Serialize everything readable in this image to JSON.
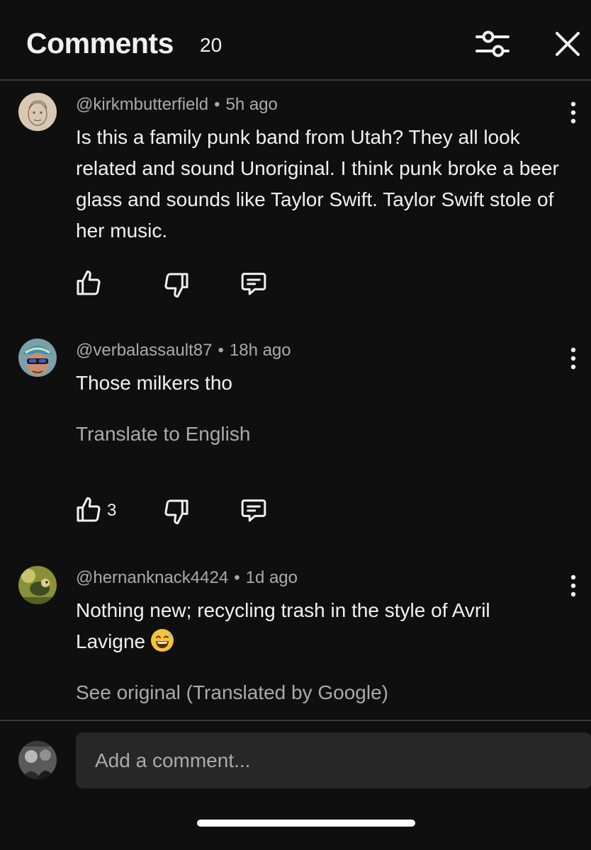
{
  "header": {
    "title": "Comments",
    "count": "20",
    "filter_icon": "filter-sliders-icon",
    "close_icon": "close-icon"
  },
  "comments": [
    {
      "author": "@kirkmbutterfield",
      "time": "5h ago",
      "text": "Is this a family punk band from Utah? They all look related and sound Unoriginal. I think punk broke a beer glass and sounds like Taylor Swift. Taylor Swift stole of her music.",
      "likes": "",
      "avatar_icon": "sketch-portrait-avatar"
    },
    {
      "author": "@verbalassault87",
      "time": "18h ago",
      "text": "Those milkers tho",
      "translate": "Translate to English",
      "likes": "3",
      "avatar_icon": "sunglasses-hat-avatar"
    },
    {
      "author": "@hernanknack4424",
      "time": "1d ago",
      "text": "Nothing new; recycling trash in the style of Avril Lavigne",
      "emoji": "grinning-sweat-emoji",
      "translate": "See original (Translated by Google)",
      "avatar_icon": "bird-photo-avatar"
    }
  ],
  "composer": {
    "placeholder": "Add a comment...",
    "avatar_icon": "user-photo-avatar"
  },
  "colors": {
    "background": "#0f0f0f",
    "divider": "#3a3a3a",
    "input_background": "#272727",
    "secondary_text": "#aaaaaa",
    "primary_text": "#f1f1f1"
  }
}
